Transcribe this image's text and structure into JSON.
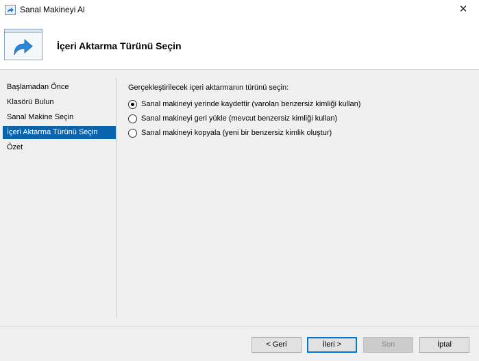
{
  "window": {
    "title": "Sanal Makineyi Al",
    "close_glyph": "✕"
  },
  "header": {
    "title": "İçeri Aktarma Türünü Seçin",
    "icon": "import-arrow-icon"
  },
  "nav": {
    "items": [
      {
        "label": "Başlamadan Önce",
        "active": false
      },
      {
        "label": "Klasörü Bulun",
        "active": false
      },
      {
        "label": "Sanal Makine Seçin",
        "active": false
      },
      {
        "label": "İçeri Aktarma Türünü Seçin",
        "active": true
      },
      {
        "label": "Özet",
        "active": false
      }
    ]
  },
  "main": {
    "prompt": "Gerçekleştirilecek içeri aktarmanın türünü seçin:",
    "options": [
      {
        "label": "Sanal makineyi yerinde kaydettir (varolan benzersiz kimliği kullan)",
        "checked": true
      },
      {
        "label": "Sanal makineyi geri yükle (mevcut benzersiz kimliği kullan)",
        "checked": false
      },
      {
        "label": "Sanal makineyi kopyala (yeni bir benzersiz kimlik oluştur)",
        "checked": false
      }
    ]
  },
  "footer": {
    "back_label": "< Geri",
    "next_label": "İleri >",
    "finish_label": "Son",
    "cancel_label": "İptal"
  },
  "colors": {
    "selection": "#0a64ad",
    "focus_border": "#0078d7"
  }
}
